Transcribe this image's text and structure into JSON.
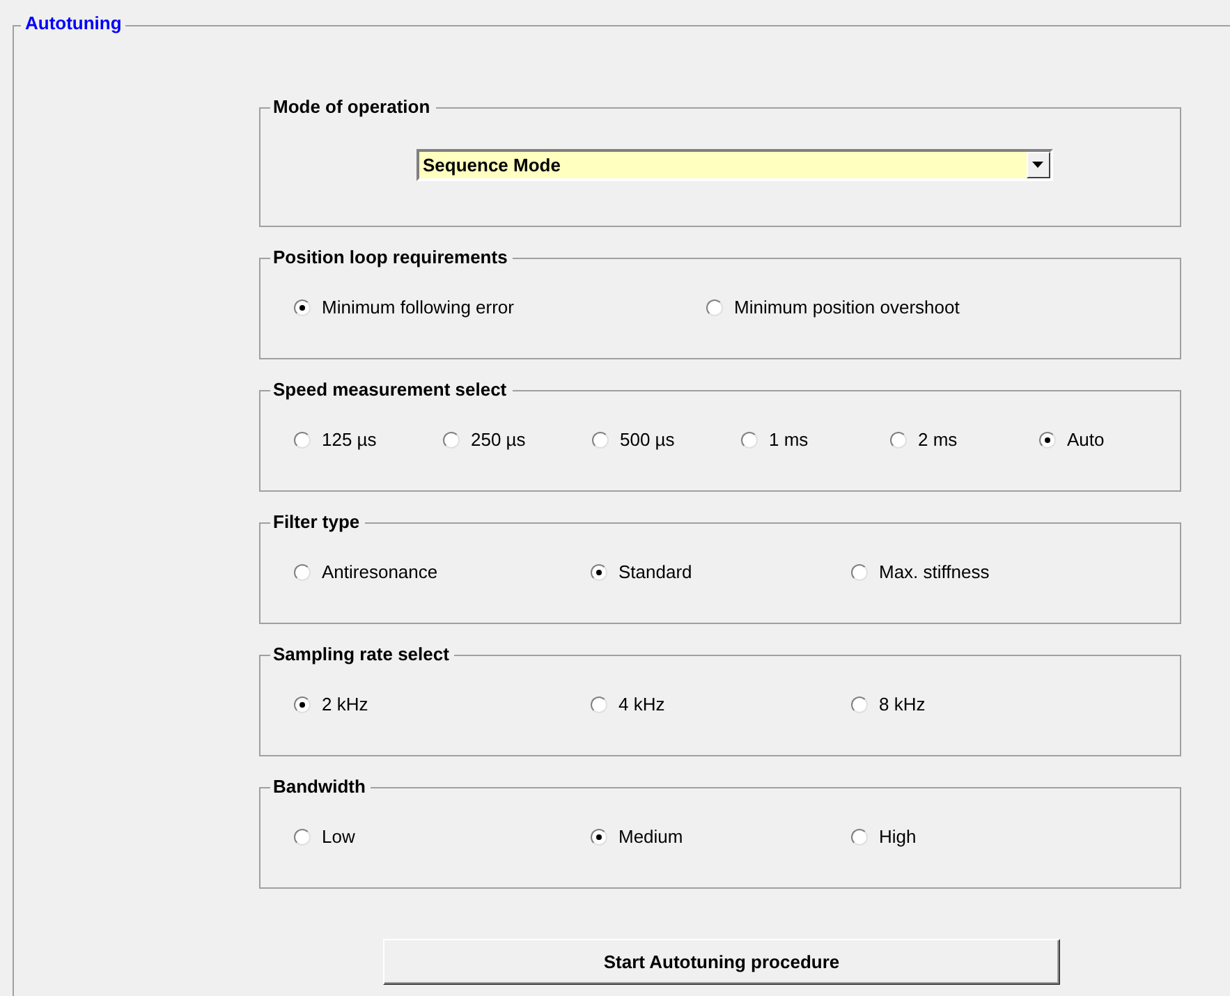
{
  "panel": {
    "title": "Autotuning"
  },
  "mode": {
    "title": "Mode of operation",
    "value": "Sequence Mode"
  },
  "groups": [
    {
      "title": "Position loop requirements",
      "options": [
        {
          "label": "Minimum following error",
          "selected": true
        },
        {
          "label": "Minimum position overshoot",
          "selected": false
        }
      ]
    },
    {
      "title": "Speed measurement select",
      "options": [
        {
          "label": "125 µs",
          "selected": false
        },
        {
          "label": "250 µs",
          "selected": false
        },
        {
          "label": "500 µs",
          "selected": false
        },
        {
          "label": "1 ms",
          "selected": false
        },
        {
          "label": "2 ms",
          "selected": false
        },
        {
          "label": "Auto",
          "selected": true
        }
      ]
    },
    {
      "title": "Filter type",
      "options": [
        {
          "label": "Antiresonance",
          "selected": false
        },
        {
          "label": "Standard",
          "selected": true
        },
        {
          "label": "Max. stiffness",
          "selected": false
        }
      ]
    },
    {
      "title": "Sampling rate select",
      "options": [
        {
          "label": "2 kHz",
          "selected": true
        },
        {
          "label": "4 kHz",
          "selected": false
        },
        {
          "label": "8 kHz",
          "selected": false
        }
      ]
    },
    {
      "title": "Bandwidth",
      "options": [
        {
          "label": "Low",
          "selected": false
        },
        {
          "label": "Medium",
          "selected": true
        },
        {
          "label": "High",
          "selected": false
        }
      ]
    }
  ],
  "button": "Start Autotuning procedure"
}
